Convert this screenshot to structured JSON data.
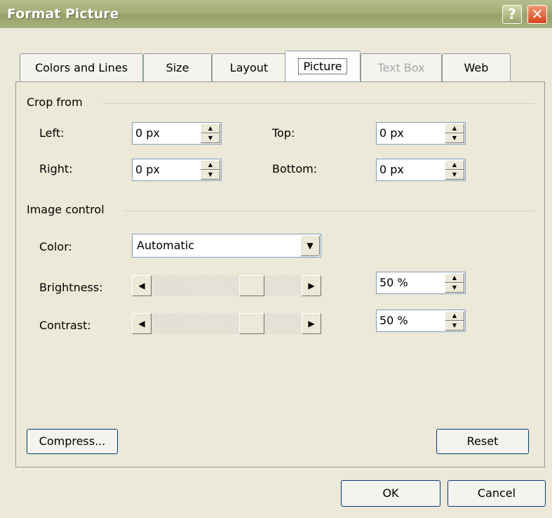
{
  "window": {
    "title": "Format Picture"
  },
  "tabs": [
    {
      "label": "Colors and Lines"
    },
    {
      "label": "Size"
    },
    {
      "label": "Layout"
    },
    {
      "label": "Picture",
      "active": true
    },
    {
      "label": "Text Box",
      "disabled": true
    },
    {
      "label": "Web"
    }
  ],
  "crop": {
    "title": "Crop from",
    "left": {
      "label": "Left:",
      "value": "0 px"
    },
    "top": {
      "label": "Top:",
      "value": "0 px"
    },
    "right": {
      "label": "Right:",
      "value": "0 px"
    },
    "bottom": {
      "label": "Bottom:",
      "value": "0 px"
    }
  },
  "image_control": {
    "title": "Image control",
    "color": {
      "label": "Color:",
      "value": "Automatic"
    },
    "brightness": {
      "label": "Brightness:",
      "value": "50 %",
      "level": 0.5
    },
    "contrast": {
      "label": "Contrast:",
      "value": "50 %",
      "level": 0.5
    }
  },
  "buttons": {
    "compress": "Compress...",
    "reset": "Reset",
    "ok": "OK",
    "cancel": "Cancel"
  },
  "colors": {
    "title_bar": "#a3ad77",
    "close_button": "#d6451d",
    "dialog_bg": "#ece9d8"
  },
  "icons": [
    "help-icon",
    "close-icon",
    "spin-up-icon",
    "spin-down-icon",
    "dropdown-arrow-icon",
    "scroll-left-icon",
    "scroll-right-icon"
  ]
}
